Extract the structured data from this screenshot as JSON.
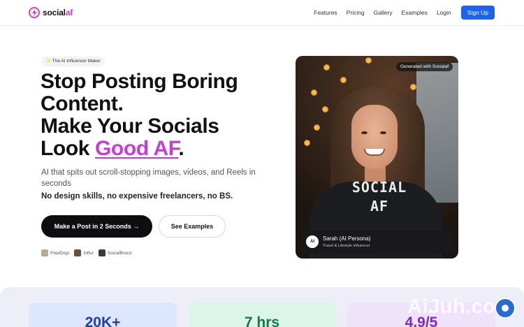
{
  "nav": {
    "logo_text": "social",
    "logo_accent": "af",
    "links": [
      "Features",
      "Pricing",
      "Gallery",
      "Examples",
      "Login"
    ],
    "signup": "Sign Up"
  },
  "hero": {
    "pill": "✨ The AI Influencer Maker",
    "headline_1": "Stop Posting Boring Content.",
    "headline_2": "Make Your Socials Look ",
    "headline_accent": "Good AF",
    "headline_end": ".",
    "sub": "AI that spits out scroll-stopping images, videos, and Reels in seconds",
    "sub_bold": "No design skills, no expensive freelancers, no BS.",
    "cta_primary": "Make a Post in 2 Seconds →",
    "cta_secondary": "See Examples",
    "brands": [
      {
        "name": "PixelDojo",
        "color": "#b7a89c"
      },
      {
        "name": "Influr",
        "color": "#6a4d3a"
      },
      {
        "name": "SocialBoost",
        "color": "#3a3a3a"
      }
    ]
  },
  "photo": {
    "badge": "Generated with Socialaf",
    "shirt_text_1": "SOCIAL",
    "shirt_text_2": "AF",
    "persona_avatar": "AI",
    "persona_name": "Sarah (AI Persona)",
    "persona_role": "Travel & Lifestyle Influencer"
  },
  "stats": [
    {
      "value": "20K+"
    },
    {
      "value": "7 hrs"
    },
    {
      "value": "4.9/5"
    }
  ],
  "watermark": "AiJuh.com",
  "colors": {
    "accent": "#c73cd8",
    "primary_button": "#1e63e8"
  }
}
